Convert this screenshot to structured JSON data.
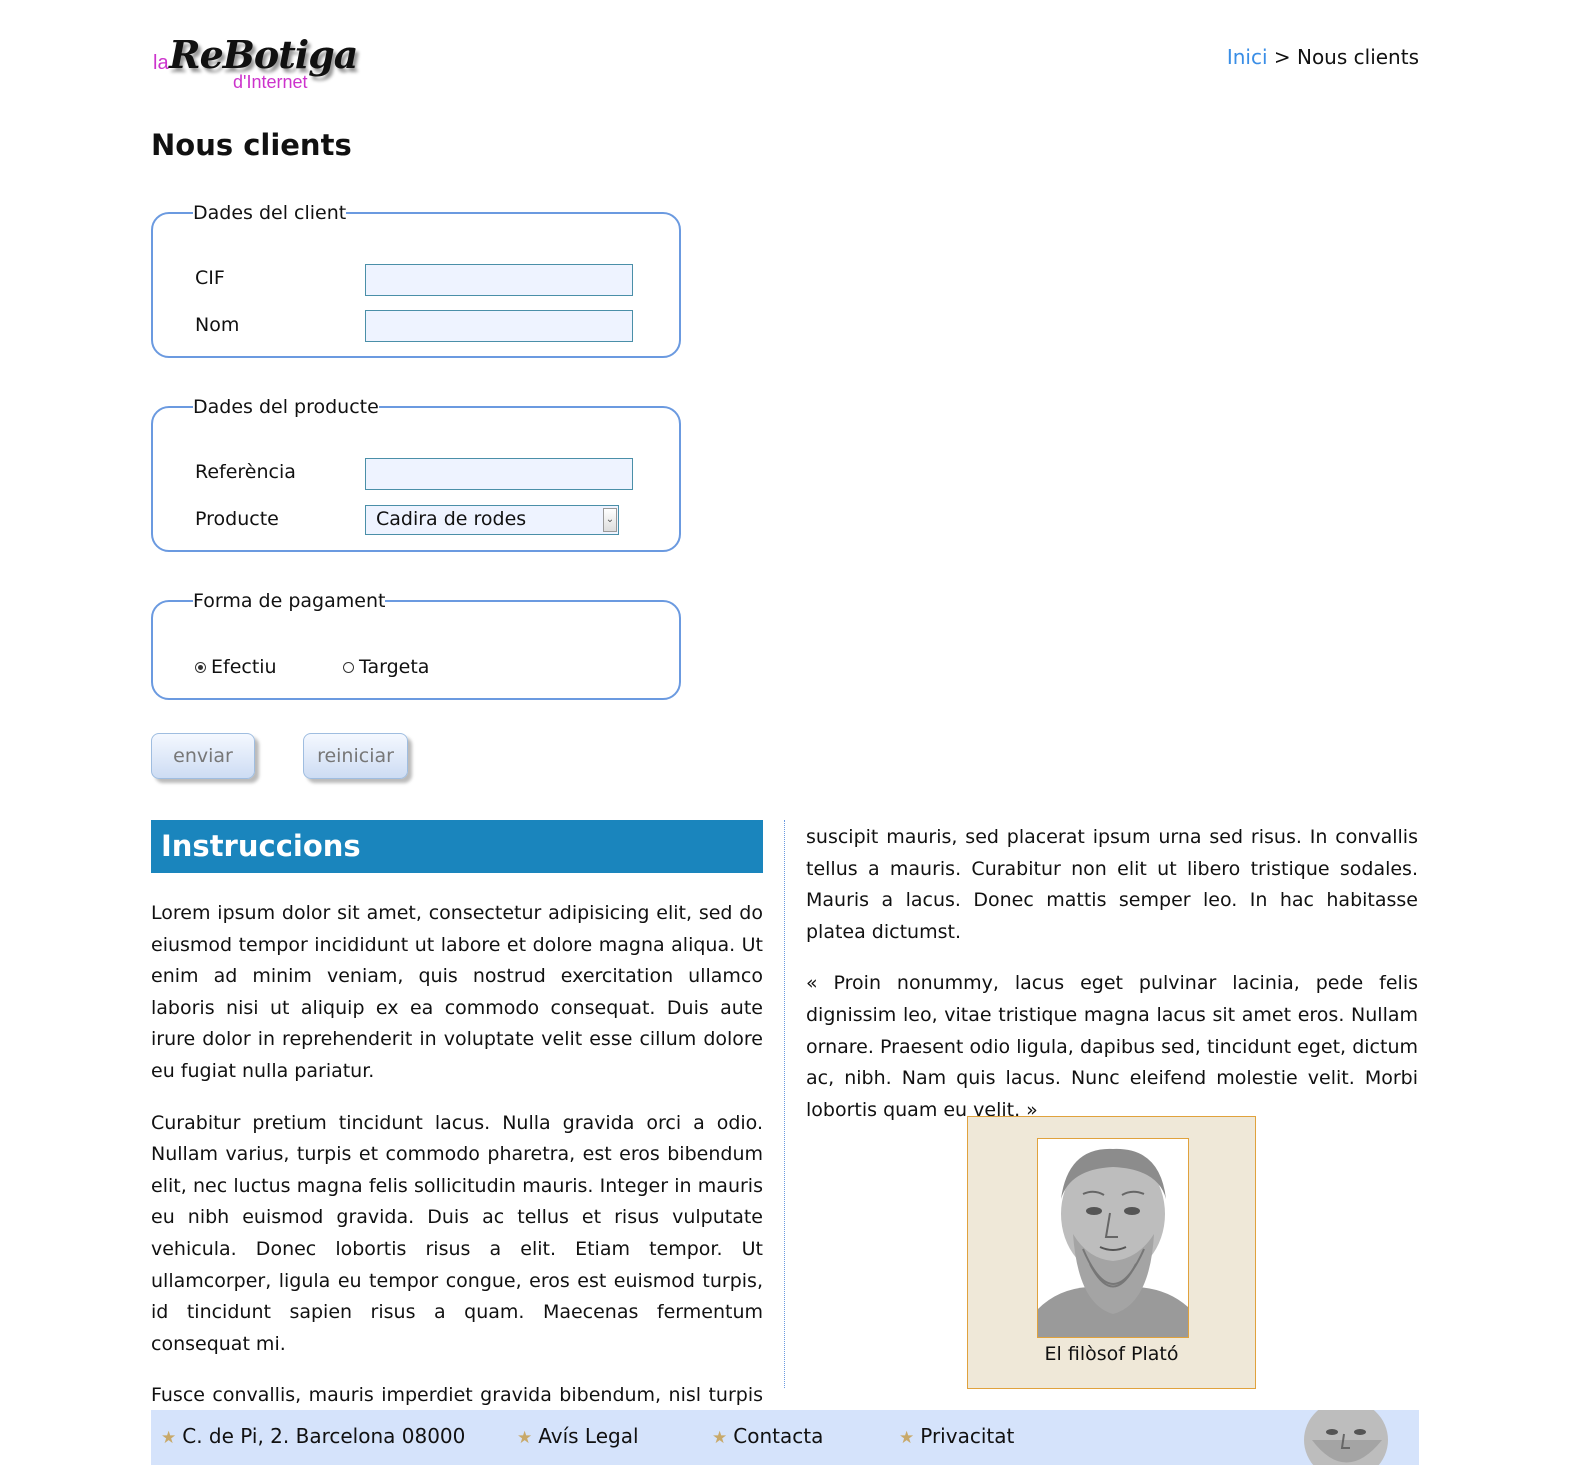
{
  "logo": {
    "prefix": "la",
    "name": "ReBotiga",
    "suffix": "d'Internet"
  },
  "breadcrumb": {
    "home": "Inici",
    "separator": ">",
    "current": "Nous clients"
  },
  "page_title": "Nous clients",
  "client_fieldset": {
    "legend": "Dades del client",
    "cif_label": "CIF",
    "cif_value": "",
    "name_label": "Nom",
    "name_value": ""
  },
  "product_fieldset": {
    "legend": "Dades del producte",
    "ref_label": "Referència",
    "ref_value": "",
    "product_label": "Producte",
    "product_selected": "Cadira de rodes"
  },
  "payment_fieldset": {
    "legend": "Forma de pagament",
    "options": [
      {
        "label": "Efectiu",
        "checked": true
      },
      {
        "label": "Targeta",
        "checked": false
      }
    ]
  },
  "buttons": {
    "submit": "enviar",
    "reset": "reiniciar"
  },
  "instructions": {
    "title": "Instruccions",
    "paragraphs": [
      "Lorem ipsum dolor sit amet, consectetur adipisicing elit, sed do eiusmod tempor incididunt ut labore et dolore magna aliqua. Ut enim ad minim veniam, quis nostrud exercitation ullamco laboris nisi ut aliquip ex ea commodo consequat. Duis aute irure dolor in reprehenderit in voluptate velit esse cillum dolore eu fugiat nulla pariatur.",
      "Curabitur pretium tincidunt lacus. Nulla gravida orci a odio. Nullam varius, turpis et commodo pharetra, est eros bibendum elit, nec luctus magna felis sollicitudin mauris. Integer in mauris eu nibh euismod gravida. Duis ac tellus et risus vulputate vehicula. Donec lobortis risus a elit. Etiam tempor. Ut ullamcorper, ligula eu tempor congue, eros est euismod turpis, id tincidunt sapien risus a quam. Maecenas fermentum consequat mi.",
      "Fusce convallis, mauris imperdiet gravida bibendum, nisl turpis"
    ],
    "continuation": "suscipit mauris, sed placerat ipsum urna sed risus. In convallis tellus a mauris. Curabitur non elit ut libero tristique sodales. Mauris a lacus. Donec mattis semper leo. In hac habitasse platea dictumst.",
    "quote": "« Proin nonummy, lacus eget pulvinar lacinia, pede felis dignissim leo, vitae tristique magna lacus sit amet eros. Nullam ornare. Praesent odio ligula, dapibus sed, tincidunt eget, dictum ac, nibh. Nam quis lacus. Nunc eleifend molestie velit. Morbi lobortis quam eu velit. »"
  },
  "figure": {
    "caption": "El filòsof Plató"
  },
  "footer": {
    "address": "C. de Pi, 2. Barcelona 08000",
    "legal": "Avís Legal",
    "contact": "Contacta",
    "privacy": "Privacitat"
  },
  "colors": {
    "accent": "#1a85bd",
    "fieldset_border": "#6b9ae0",
    "link": "#3a8ee6",
    "footer_bg": "#d5e3fb",
    "logo_pink": "#cc33cc"
  }
}
